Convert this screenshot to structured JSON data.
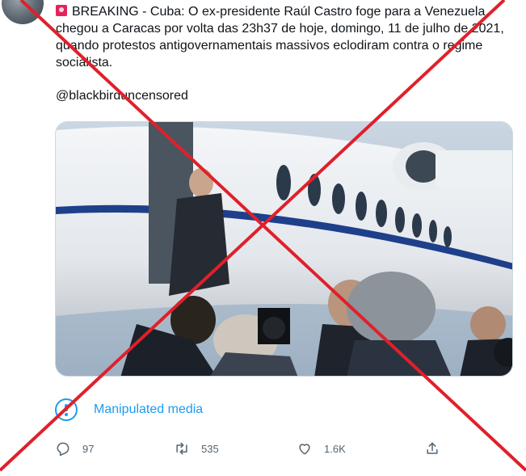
{
  "tweet": {
    "text": "BREAKING - Cuba: O ex-presidente Raúl Castro foge para a Venezuela, chegou a Caracas por volta das 23h37 de hoje, domingo, 11 de julho de 2021, quando protestos antigovernamentais massivos eclodiram contra o regime socialista.",
    "handle": "@blackbirduncensored",
    "prefix_icon": "siren-emoji-icon"
  },
  "media": {
    "description_icon": "photo"
  },
  "label": {
    "text": "Manipulated media",
    "icon": "info-circle-icon"
  },
  "actions": {
    "reply_count": "97",
    "retweet_count": "535",
    "like_count": "1.6K"
  },
  "colors": {
    "accent": "#1d9bf0",
    "fact_check_cross": "#e0202a",
    "muted": "#536471"
  }
}
